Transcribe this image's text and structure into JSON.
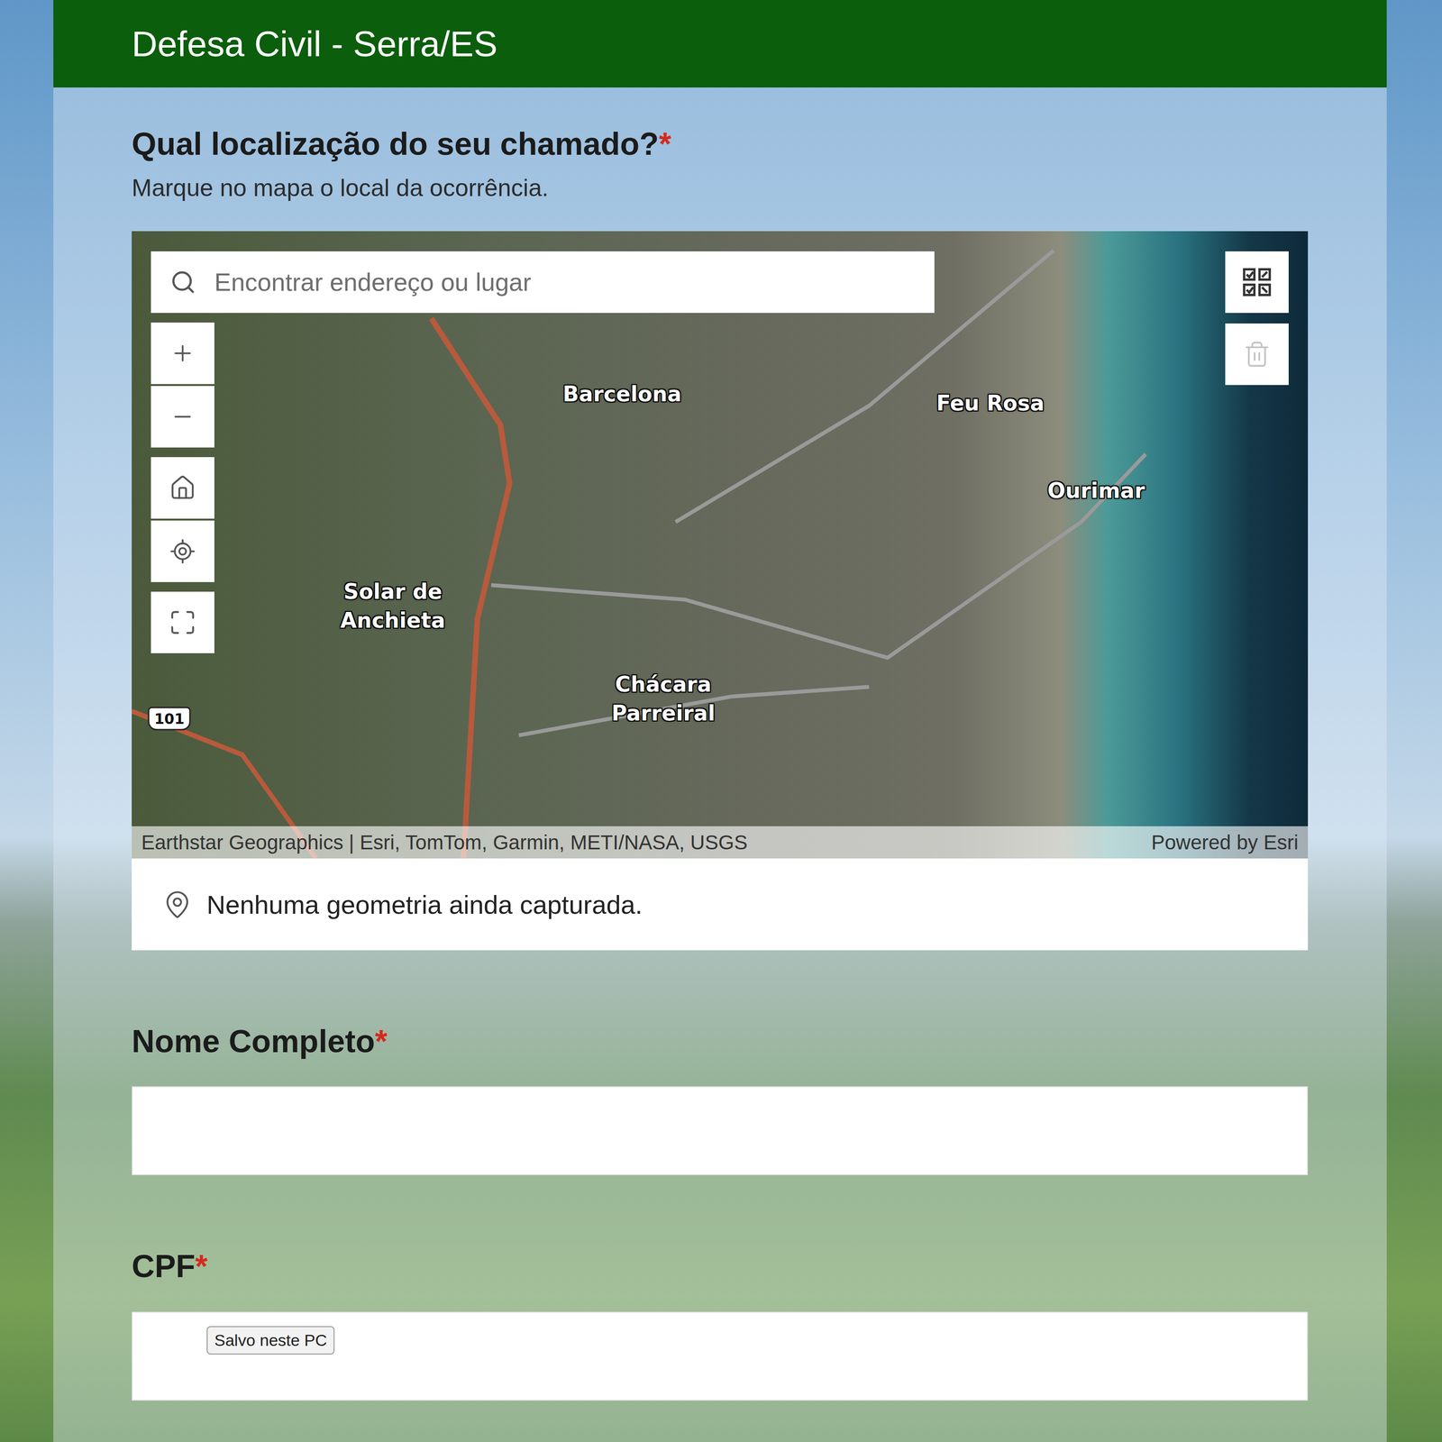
{
  "header": {
    "title": "Defesa Civil - Serra/ES"
  },
  "question": {
    "label": "Qual localização do seu chamado?",
    "requiredMark": "*",
    "hint": "Marque no mapa o local da ocorrência."
  },
  "map": {
    "search": {
      "placeholder": "Encontrar endereço ou lugar"
    },
    "labels": [
      "Barcelona",
      "Feu Rosa",
      "Ourimar",
      "Solar de Anchieta",
      "Chácara Parreiral"
    ],
    "shield": "101",
    "attribution": "Earthstar Geographics | Esri, TomTom, Garmin, METI/NASA, USGS",
    "powered": "Powered by Esri"
  },
  "geometry": {
    "status": "Nenhuma geometria ainda capturada."
  },
  "fields": [
    {
      "label": "Nome Completo",
      "requiredMark": "*",
      "value": ""
    },
    {
      "label": "CPF",
      "requiredMark": "*",
      "value": "",
      "tooltip": "Salvo neste PC"
    }
  ]
}
